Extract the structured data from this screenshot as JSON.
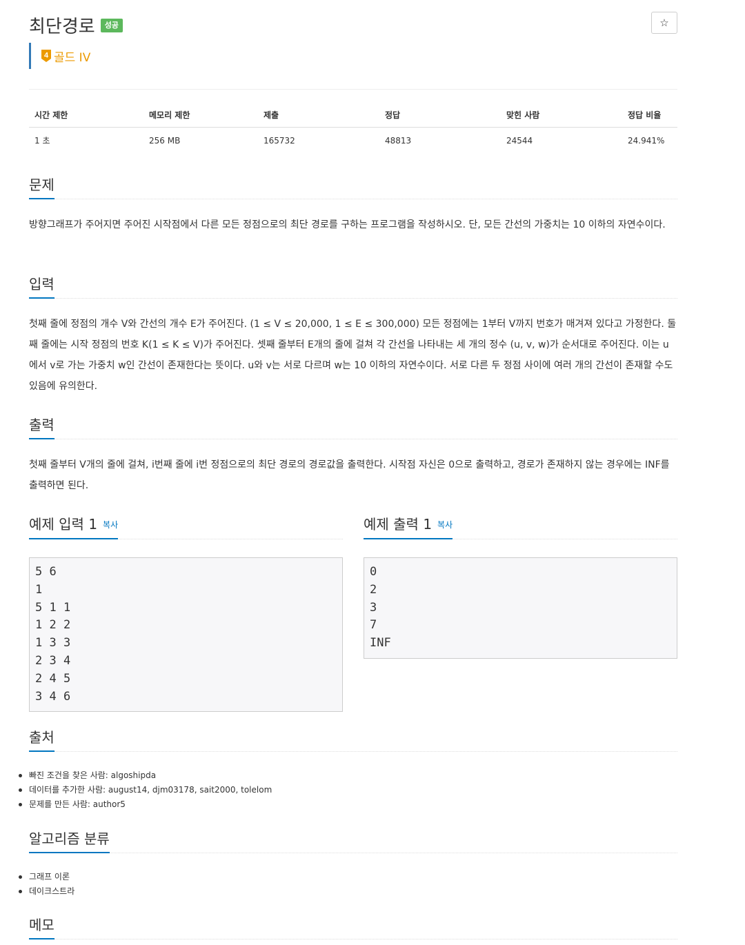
{
  "problem": {
    "title": "최단경로",
    "status_badge": "성공",
    "star_icon": "star-icon",
    "tier": {
      "number": "4",
      "label": "골드 IV",
      "color": "#ec9a00"
    }
  },
  "stats": {
    "headers": [
      "시간 제한",
      "메모리 제한",
      "제출",
      "정답",
      "맞힌 사람",
      "정답 비율"
    ],
    "values": [
      "1 초",
      "256 MB",
      "165732",
      "48813",
      "24544",
      "24.941%"
    ]
  },
  "sections": {
    "description": {
      "heading": "문제",
      "text": "방향그래프가 주어지면 주어진 시작점에서 다른 모든 정점으로의 최단 경로를 구하는 프로그램을 작성하시오. 단, 모든 간선의 가중치는 10 이하의 자연수이다."
    },
    "input": {
      "heading": "입력",
      "text": "첫째 줄에 정점의 개수 V와 간선의 개수 E가 주어진다. (1 ≤ V ≤ 20,000, 1 ≤ E ≤ 300,000) 모든 정점에는 1부터 V까지 번호가 매겨져 있다고 가정한다. 둘째 줄에는 시작 정점의 번호 K(1 ≤ K ≤ V)가 주어진다. 셋째 줄부터 E개의 줄에 걸쳐 각 간선을 나타내는 세 개의 정수 (u, v, w)가 순서대로 주어진다. 이는 u에서 v로 가는 가중치 w인 간선이 존재한다는 뜻이다. u와 v는 서로 다르며 w는 10 이하의 자연수이다. 서로 다른 두 정점 사이에 여러 개의 간선이 존재할 수도 있음에 유의한다."
    },
    "output": {
      "heading": "출력",
      "text": "첫째 줄부터 V개의 줄에 걸쳐, i번째 줄에 i번 정점으로의 최단 경로의 경로값을 출력한다. 시작점 자신은 0으로 출력하고, 경로가 존재하지 않는 경우에는 INF를 출력하면 된다."
    },
    "sample_input": {
      "heading": "예제 입력 1",
      "copy_label": "복사",
      "content": "5 6\n1\n5 1 1\n1 2 2\n1 3 3\n2 3 4\n2 4 5\n3 4 6"
    },
    "sample_output": {
      "heading": "예제 출력 1",
      "copy_label": "복사",
      "content": "0\n2\n3\n7\nINF"
    },
    "source": {
      "heading": "출처",
      "items": [
        "빠진 조건을 찾은 사람: algoshipda",
        "데이터를 추가한 사람: august14, djm03178, sait2000, tolelom",
        "문제를 만든 사람: author5"
      ]
    },
    "tags": {
      "heading": "알고리즘 분류",
      "items": [
        "그래프 이론",
        "데이크스트라"
      ]
    },
    "memo": {
      "heading": "메모"
    }
  }
}
